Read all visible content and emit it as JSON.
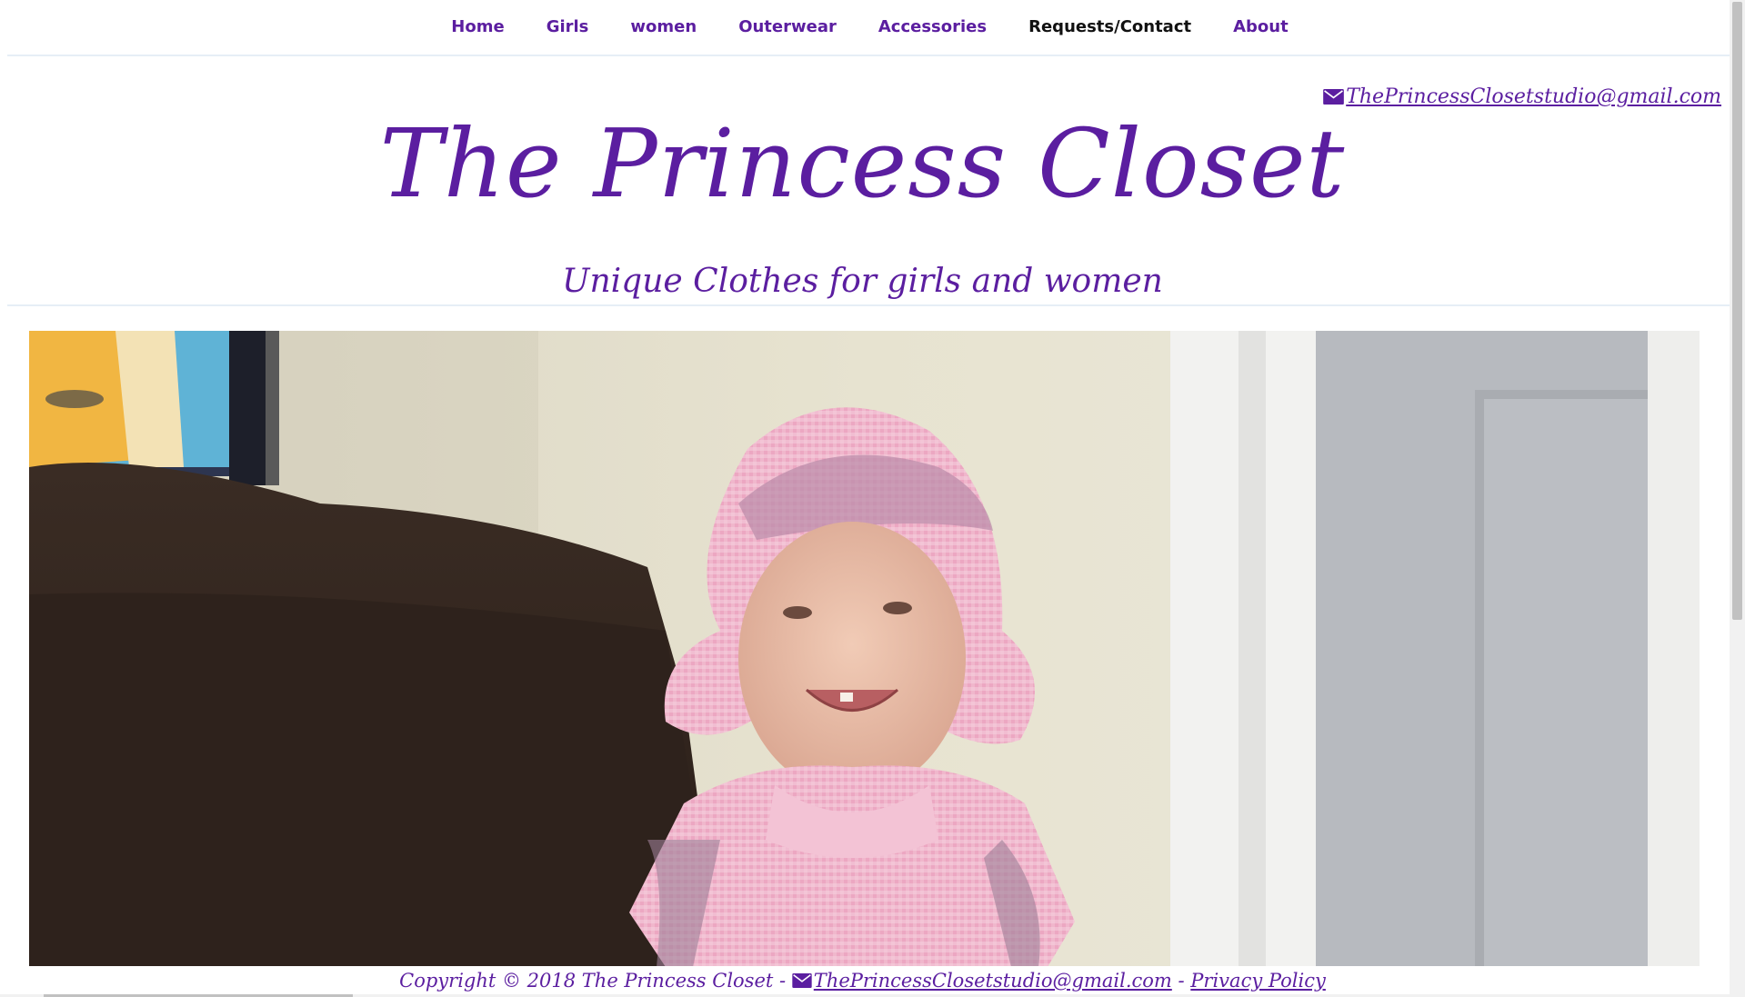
{
  "nav": {
    "items": [
      {
        "label": "Home"
      },
      {
        "label": "Girls"
      },
      {
        "label": "women"
      },
      {
        "label": "Outerwear"
      },
      {
        "label": "Accessories"
      },
      {
        "label": "Requests/Contact"
      },
      {
        "label": "About"
      }
    ],
    "active": "Requests/Contact"
  },
  "header": {
    "email": "ThePrincessClosetstudio@gmail.com",
    "title": "The Princess Closet",
    "subtitle": "Unique Clothes for girls and women"
  },
  "hero": {
    "icon": "photo-of-toddler-in-pink-hat"
  },
  "footer": {
    "copyright": "Copyright © 2018 The Princess Closet -",
    "email": "ThePrincessClosetstudio@gmail.com",
    "separator": "-",
    "privacy": "Privacy Policy"
  },
  "colors": {
    "brand": "#5b1ea0",
    "active_nav": "#111111",
    "divider": "#e6eef6"
  }
}
